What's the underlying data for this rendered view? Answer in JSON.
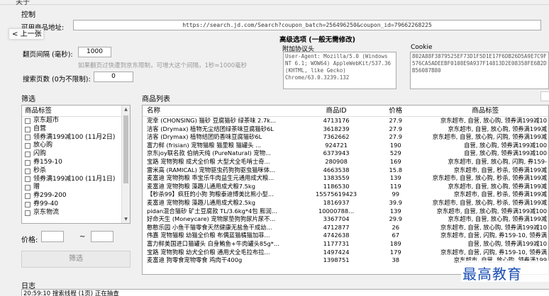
{
  "window": {
    "title": "关于"
  },
  "control": {
    "title": "控制",
    "url_label": "可用商品地址:",
    "url_value": "https://search.jd.com/Search?coupon_batch=256496250&coupon_id=79662268225",
    "interval_label": "翻页间隔 (毫秒):",
    "interval_value": "1000",
    "interval_hint": "如果翻页过快遭到京东限制，可增大这个间隔，1秒=1000毫秒",
    "pages_label": "搜索页数 (0为不限制):",
    "pages_value": "0"
  },
  "back_button": {
    "label": "上一张"
  },
  "advanced": {
    "title": "高级选项 (一般无需修改)",
    "headers_label": "附加协议头",
    "headers_value": "User-Agent: Mozilla/5.0 (Windows NT 6.1; WOW64) AppleWebKit/537.36 (KHTML, like Gecko) Chrome/63.0.3239.132",
    "cookie_label": "Cookie",
    "cookie_value": "802A88F3879525EF73D1F5D1E17F6DB26D5A9E7C9F576CA5ADEEBF0108E9A937F14813D2E08358FE6B2DB56087B80"
  },
  "filter": {
    "title": "筛选",
    "header": "商品标签",
    "items": [
      {
        "label": "京东超市",
        "checked": false
      },
      {
        "label": "自营",
        "checked": false
      },
      {
        "label": "领券满199减100 (11月2日)",
        "checked": false
      },
      {
        "label": "放心购",
        "checked": false
      },
      {
        "label": "闪购",
        "checked": false
      },
      {
        "label": "券159-10",
        "checked": false
      },
      {
        "label": "秒杀",
        "checked": false
      },
      {
        "label": "领券满199减100 (11月1日)",
        "checked": false
      },
      {
        "label": "赠",
        "checked": false
      },
      {
        "label": "券299-200",
        "checked": false
      },
      {
        "label": "券99-40",
        "checked": false
      },
      {
        "label": "京东物流",
        "checked": false
      }
    ],
    "price_label": "价格:",
    "price_min": "",
    "price_sep": "~",
    "price_max": "",
    "button_label": "筛选"
  },
  "products": {
    "title": "商品列表",
    "columns": {
      "name": "名称",
      "id": "商品ID",
      "price": "价格",
      "tags": "商品标签"
    },
    "rows": [
      {
        "name": "宠幸 (CHONSING) 猫砂 豆腐猫砂 绿茶味 2.7k...",
        "id": "4713176",
        "price": "27.9",
        "tags": "京东超市, 自营, 放心购, 领券满199减10"
      },
      {
        "name": "洁客 (Drymax) 植物无尘结团绿茶味豆腐猫砂6L",
        "id": "3618239",
        "price": "27.9",
        "tags": "京东超市, 自营, 放心购, 领券满199减"
      },
      {
        "name": "洁客 (Drymax) 植物结团奶香味豆腐猫砂6L",
        "id": "7362662",
        "price": "27.9",
        "tags": "京东超市, 自营, 放心购, 闪购, 领券满199减"
      },
      {
        "name": "富力鲜 (frisian) 宠物猫粮 猫里粮 猫罐头 ...",
        "id": "924721",
        "price": "190",
        "tags": "自营, 放心购, 领券满199减100"
      },
      {
        "name": "京东joy联名款 伯纳天纯 (PureNatural) 宠物...",
        "id": "6373943",
        "price": "529",
        "tags": "自营, 放心购, 领券满199减100"
      },
      {
        "name": "宝路 宠物狗粮 成犬全价粮 大型犬全毛啃士奇...",
        "id": "280908",
        "price": "169",
        "tags": "京东超市, 自营, 放心购, 闪购, 券159-"
      },
      {
        "name": "雷米高 (RAMICAL) 宠物驱虫药狗狗驱虫猫咪体...",
        "id": "4663538",
        "price": "15.8",
        "tags": "京东超市, 自营, 秒杀, 领券满199减"
      },
      {
        "name": "麦富迪 宠物狗粮 乖宝乐牛肉益生元通用成犬粮...",
        "id": "1383559",
        "price": "139",
        "tags": "京东超市, 自营, 放心购, 秒杀, 领券满199减"
      },
      {
        "name": "麦富迪 宠物狗粮 藻趣儿通用成犬粮7.5kg",
        "id": "1186530",
        "price": "119",
        "tags": "京东超市, 自营, 放心购, 领券满199减"
      },
      {
        "name": "【秒杀99】疯狂的小狗 狗粮泰迪博美比熊小型...",
        "id": "15575619423",
        "price": "99",
        "tags": "京东超市, 自营, 秒杀, 领券满199减"
      },
      {
        "name": "麦富迪 宠物狗粮 藻趣儿通用成犬粮2.5kg",
        "id": "1816937",
        "price": "39.9",
        "tags": "京东超市, 自营, 放心购, 秒杀, 领券满199减"
      },
      {
        "name": "pidan混合猫砂 矿土豆腐款 TL/3.6kg*4包 膨润...",
        "id": "10000788...",
        "price": "139",
        "tags": "京东超市, 自营, 放心购, 领券满199减100"
      },
      {
        "name": "好命天生 (Moneycare) 宠物尿垫狗狗尿片尿不...",
        "id": "3367704",
        "price": "29.9",
        "tags": "京东超市, 自营, 放心购, 领券满199减"
      },
      {
        "name": "憨憨乐园 小鱼干猫零食天然健康无盐鱼干成幼...",
        "id": "4712877",
        "price": "26",
        "tags": "京东超市, 自营, 放心购, 领券满199减10"
      },
      {
        "name": "伟嘉 宠物猫粮 幼猫全价粮 布偶蓝猫橘猫加菲...",
        "id": "4742638",
        "price": "67",
        "tags": "京东超市, 自营, 闪购, 券159-10, 领券满"
      },
      {
        "name": "富力鲜美国进口猫罐头 白身鲔鱼+牛肉罐头85g*...",
        "id": "1177731",
        "price": "189",
        "tags": "自营, 放心购, 领券满199减10"
      },
      {
        "name": "宝路 宠物狗粮 幼犬全价粮 通用犬全毛拉布拉...",
        "id": "1497424",
        "price": "179",
        "tags": "京东超市, 自营, 闪购, 券159-10, 领券满"
      },
      {
        "name": "麦富迪 狗零食宠物零食 鸡肉干400g",
        "id": "1398751",
        "price": "38",
        "tags": "京东超市, 自营, 放心购, 领券满199"
      }
    ]
  },
  "log": {
    "title": "日志",
    "line": "20:59:10 搜索线程 (1页) 正在抽查"
  },
  "watermark": "最高教育"
}
